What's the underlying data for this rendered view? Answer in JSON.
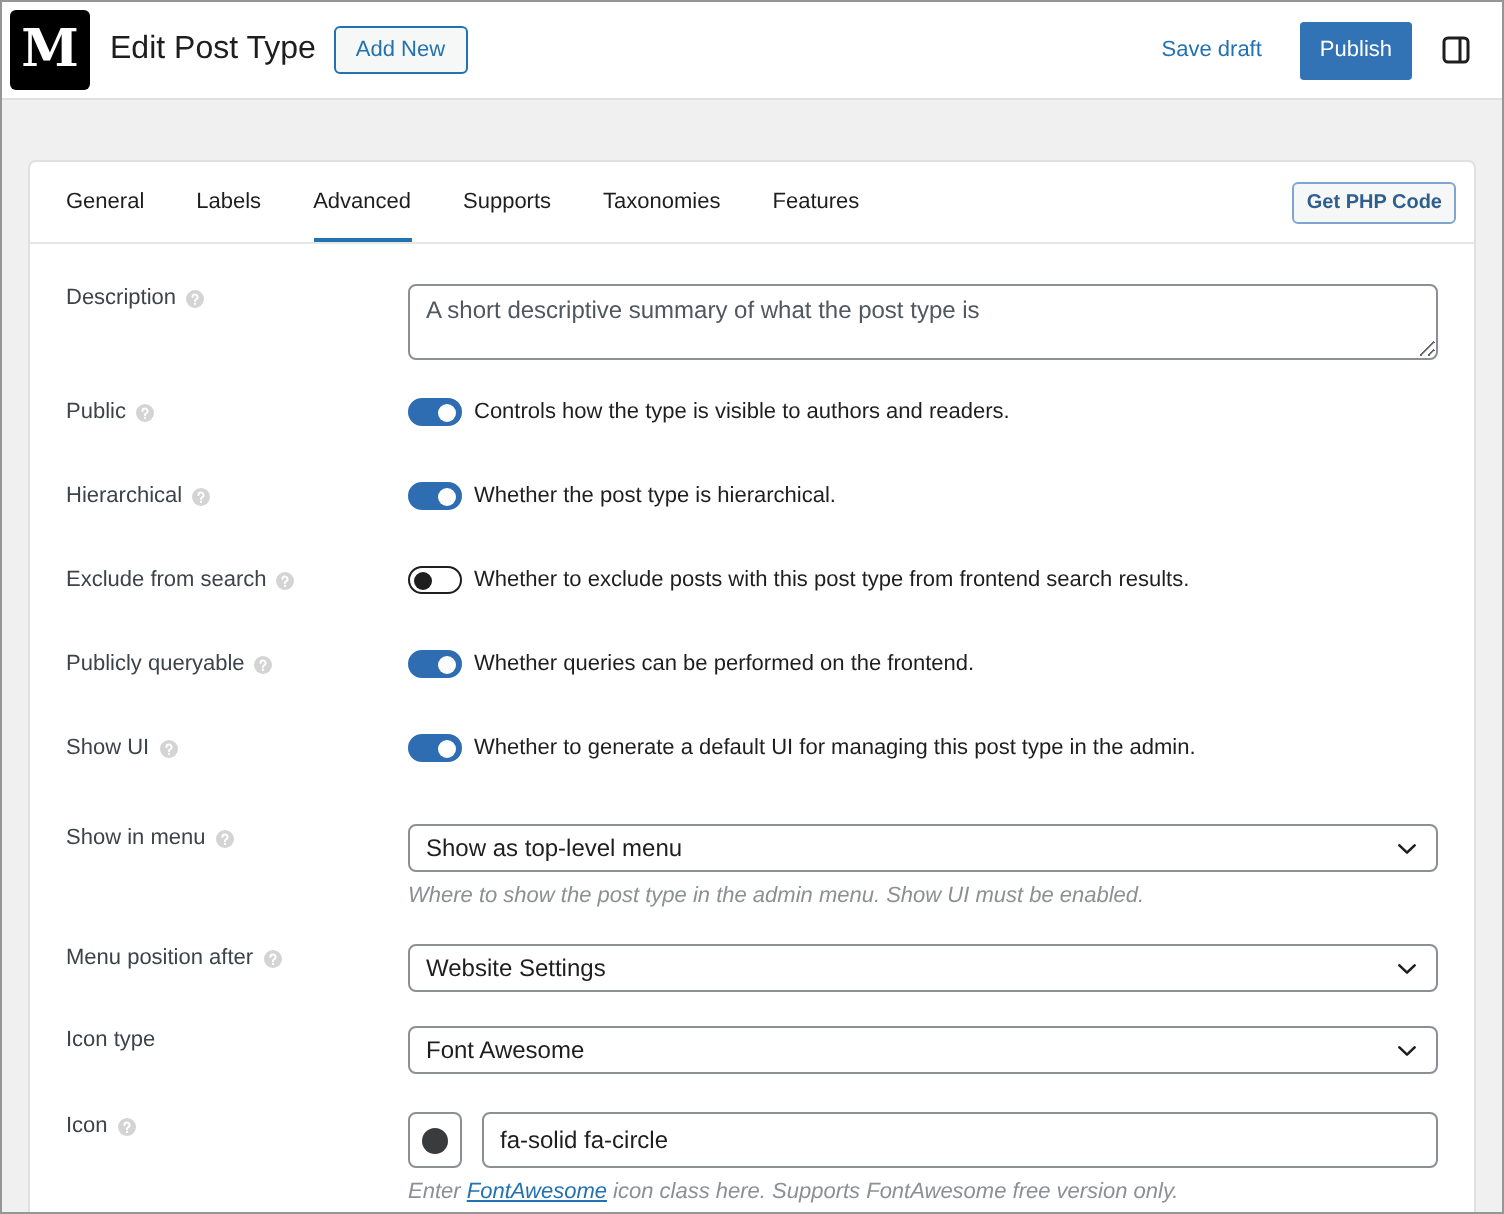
{
  "header": {
    "logo": "M",
    "title": "Edit Post Type",
    "add_new": "Add New",
    "save_draft": "Save draft",
    "publish": "Publish"
  },
  "tabs": [
    {
      "label": "General",
      "selected": false
    },
    {
      "label": "Labels",
      "selected": false
    },
    {
      "label": "Advanced",
      "selected": true
    },
    {
      "label": "Supports",
      "selected": false
    },
    {
      "label": "Taxonomies",
      "selected": false
    },
    {
      "label": "Features",
      "selected": false
    }
  ],
  "get_php_code": "Get PHP Code",
  "fields": [
    {
      "kind": "textarea",
      "label": "Description",
      "help": true,
      "placeholder": "A short descriptive summary of what the post type is"
    },
    {
      "kind": "toggle",
      "label": "Public",
      "help": true,
      "on": true,
      "description": "Controls how the type is visible to authors and readers."
    },
    {
      "kind": "toggle",
      "label": "Hierarchical",
      "help": true,
      "on": true,
      "description": "Whether the post type is hierarchical."
    },
    {
      "kind": "toggle",
      "label": "Exclude from search",
      "help": true,
      "on": false,
      "description": "Whether to exclude posts with this post type from frontend search results."
    },
    {
      "kind": "toggle",
      "label": "Publicly queryable",
      "help": true,
      "on": true,
      "description": "Whether queries can be performed on the frontend."
    },
    {
      "kind": "toggle",
      "label": "Show UI",
      "help": true,
      "on": true,
      "description": "Whether to generate a default UI for managing this post type in the admin."
    },
    {
      "kind": "select",
      "label": "Show in menu",
      "help": true,
      "value": "Show as top-level menu",
      "hint": [
        {
          "kind": "text",
          "text": "Where to show the post type in the admin menu. Show UI must be enabled."
        }
      ]
    },
    {
      "kind": "select",
      "label": "Menu position after",
      "help": true,
      "value": "Website Settings"
    },
    {
      "kind": "select",
      "label": "Icon type",
      "help": false,
      "value": "Font Awesome"
    },
    {
      "kind": "icon",
      "label": "Icon",
      "help": true,
      "value": "fa-solid fa-circle",
      "hint": [
        {
          "kind": "text",
          "text": "Enter"
        },
        {
          "kind": "link",
          "text": "FontAwesome"
        },
        {
          "kind": "text",
          "text": "icon class here. Supports FontAwesome free version only."
        }
      ]
    }
  ]
}
